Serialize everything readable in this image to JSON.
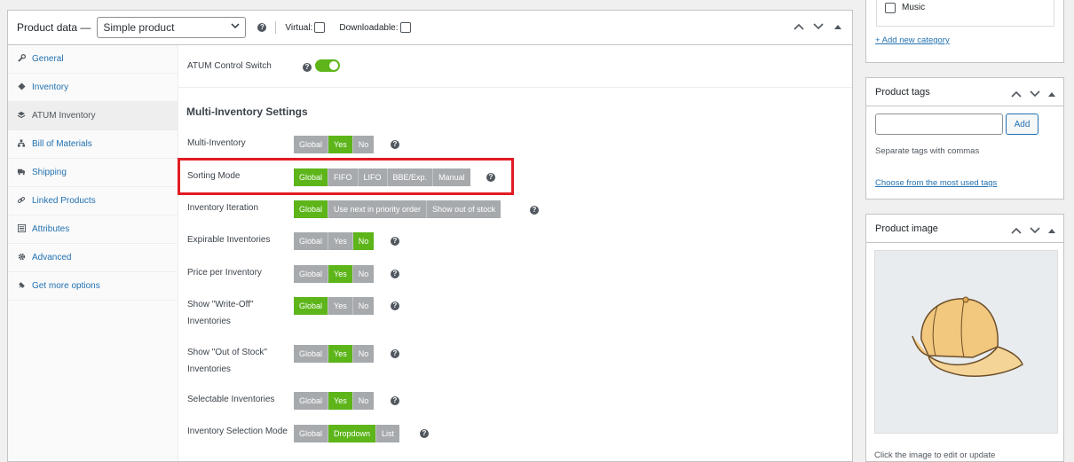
{
  "product_data": {
    "title": "Product data —",
    "type_select": "Simple product",
    "virtual_label": "Virtual:",
    "downloadable_label": "Downloadable:"
  },
  "tabs": [
    {
      "label": "General",
      "icon": "wrench-icon"
    },
    {
      "label": "Inventory",
      "icon": "tag-icon"
    },
    {
      "label": "ATUM Inventory",
      "icon": "layers-icon"
    },
    {
      "label": "Bill of Materials",
      "icon": "hierarchy-icon"
    },
    {
      "label": "Shipping",
      "icon": "truck-icon"
    },
    {
      "label": "Linked Products",
      "icon": "link-icon"
    },
    {
      "label": "Attributes",
      "icon": "list-icon"
    },
    {
      "label": "Advanced",
      "icon": "gear-icon"
    },
    {
      "label": "Get more options",
      "icon": "plugin-icon"
    }
  ],
  "atum": {
    "control_switch_label": "ATUM Control Switch",
    "control_switch_on": true,
    "section_title": "Multi-Inventory Settings",
    "settings": [
      {
        "label": "Multi-Inventory",
        "options": [
          "Global",
          "Yes",
          "No"
        ],
        "selected": "Yes"
      },
      {
        "label": "Sorting Mode",
        "options": [
          "Global",
          "FIFO",
          "LIFO",
          "BBE/Exp.",
          "Manual"
        ],
        "selected": "Global"
      },
      {
        "label": "Inventory Iteration",
        "options": [
          "Global",
          "Use next in priority order",
          "Show out of stock"
        ],
        "selected": "Global"
      },
      {
        "label": "Expirable Inventories",
        "options": [
          "Global",
          "Yes",
          "No"
        ],
        "selected": "No"
      },
      {
        "label": "Price per Inventory",
        "options": [
          "Global",
          "Yes",
          "No"
        ],
        "selected": "Yes"
      },
      {
        "label": "Show \"Write-Off\"",
        "label2": "Inventories",
        "options": [
          "Global",
          "Yes",
          "No"
        ],
        "selected": "Global"
      },
      {
        "label": "Show \"Out of Stock\"",
        "label2": "Inventories",
        "options": [
          "Global",
          "Yes",
          "No"
        ],
        "selected": "Yes"
      },
      {
        "label": "Selectable Inventories",
        "options": [
          "Global",
          "Yes",
          "No"
        ],
        "selected": "Yes"
      },
      {
        "label": "Inventory Selection Mode",
        "options": [
          "Global",
          "Dropdown",
          "List"
        ],
        "selected": "Dropdown"
      }
    ]
  },
  "categories": {
    "item_music": "Music",
    "add_new": "+ Add new category"
  },
  "product_tags": {
    "title": "Product tags",
    "add_button": "Add",
    "hint": "Separate tags with commas",
    "choose_link": "Choose from the most used tags"
  },
  "product_image": {
    "title": "Product image",
    "hint": "Click the image to edit or update"
  },
  "colors": {
    "accent_green": "#5db51a",
    "highlight_red": "#e21b23",
    "link_blue": "#2271b1"
  }
}
